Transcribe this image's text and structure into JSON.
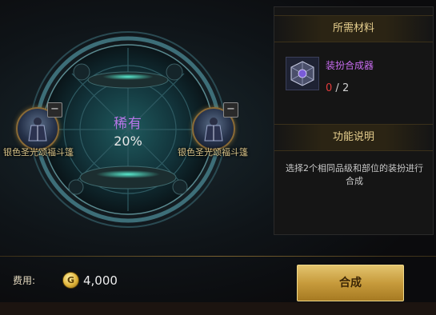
{
  "preview": {
    "rarity_label": "稀有",
    "success_rate": "20%"
  },
  "slots": [
    {
      "name": "银色圣光颂福斗篷",
      "remove_symbol": "−"
    },
    {
      "name": "银色圣光颂福斗篷",
      "remove_symbol": "−"
    }
  ],
  "materials": {
    "header": "所需材料",
    "item_name": "装扮合成器",
    "have": "0",
    "separator": " / ",
    "need": "2"
  },
  "function": {
    "header": "功能说明",
    "description": "选择2个相同品级和部位的装扮进行合成"
  },
  "fee": {
    "label": "费用:",
    "coin_symbol": "G",
    "value": "4,000"
  },
  "action": {
    "craft_label": "合成"
  },
  "colors": {
    "rarity": "#b776e8",
    "item_name": "#c86cf0",
    "insufficient": "#e23b3b",
    "header_gold": "#e7cf8e",
    "button_gold": "#c79b3c"
  }
}
